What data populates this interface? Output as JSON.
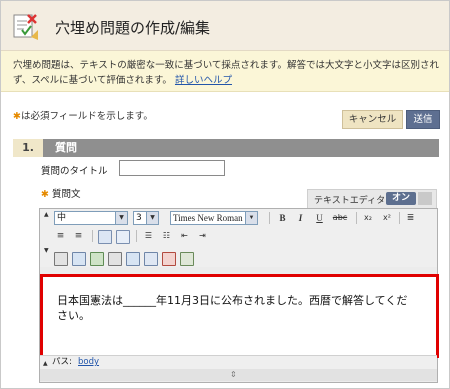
{
  "header": {
    "title": "穴埋め問題の作成/編集"
  },
  "info": {
    "text": "穴埋め問題は、テキストの厳密な一致に基づいて採点されます。解答では大文字と小文字は区別されず、スペルに基づいて評価されます。",
    "help_link": "詳しいヘルプ"
  },
  "required_note": {
    "star": "✱",
    "text": "は必須フィールドを示します。"
  },
  "buttons": {
    "cancel": "キャンセル",
    "submit": "送信"
  },
  "section": {
    "number": "1.",
    "title": "質問"
  },
  "form": {
    "question_title_label": "質問のタイトル",
    "question_title_value": "",
    "question_text_label": "質問文",
    "required_star": "✱"
  },
  "text_editor_toggle": {
    "label": "テキストエディタ:",
    "on": "オン"
  },
  "toolbar": {
    "format_select": "中",
    "size_select": "3",
    "font_select": "Times New Roman",
    "bold": "B",
    "italic": "I",
    "underline": "U",
    "strike": "abc",
    "subscript": "x₂",
    "superscript": "x²"
  },
  "editor": {
    "content": "日本国憲法は______年11月3日に公布されました。西暦で解答してください。",
    "path_label": "パス:",
    "path_value": "body"
  },
  "colors": {
    "header_bg": "#f3ede1",
    "info_bg": "#fbf6d7",
    "section_bar": "#8f8f8f",
    "submit": "#5e6f91",
    "highlight_border": "#e00000"
  }
}
